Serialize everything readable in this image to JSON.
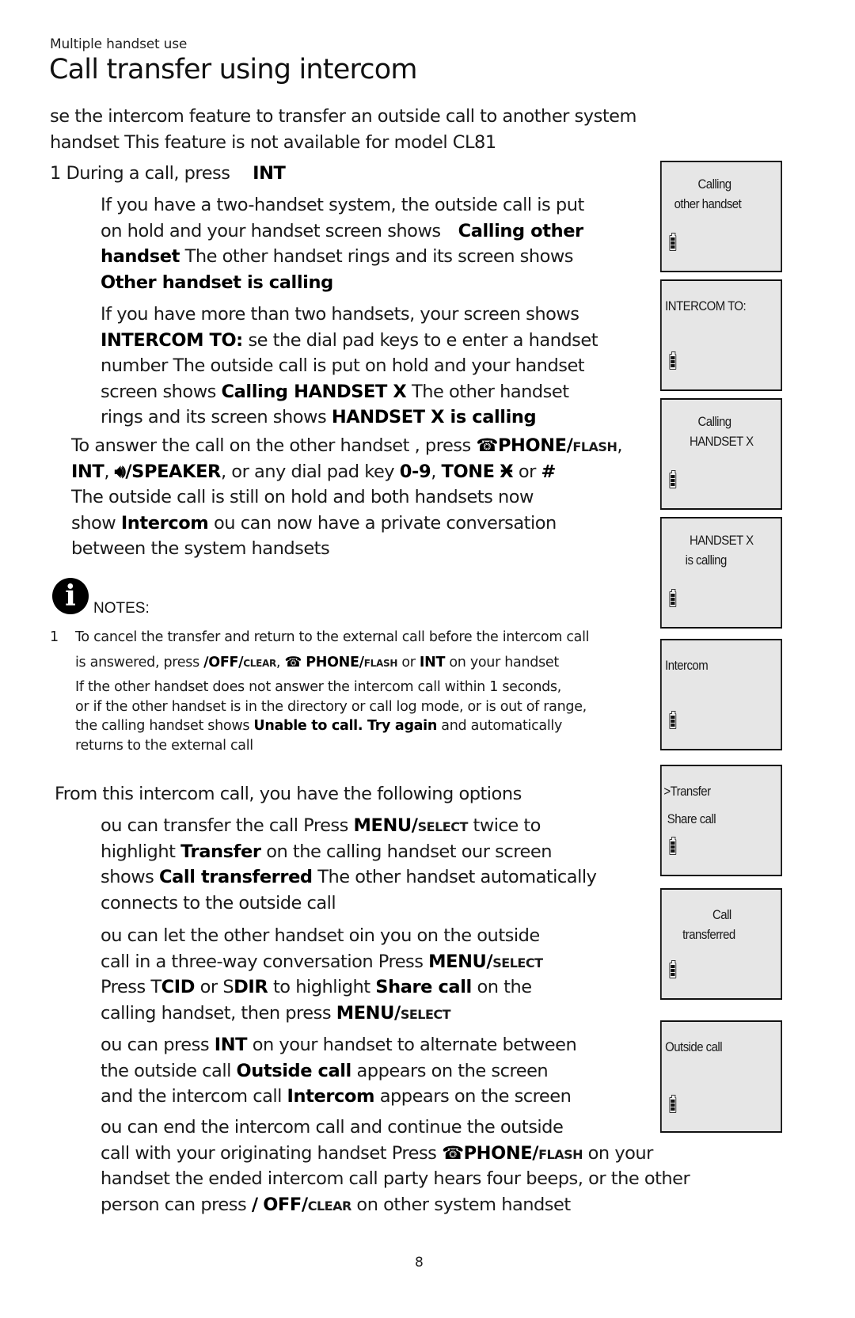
{
  "header": {
    "section_label": "Multiple handset use",
    "title": "Call transfer using intercom"
  },
  "intro": {
    "line1": "se the intercom feature to transfer an outside call to another system",
    "line2": "handset This feature is not available for model CL81"
  },
  "step1": {
    "prefix": "1 During a call, press",
    "key": "INT",
    "two_handset": {
      "l1": "If you have a   two-handset  system,  the outside call is put",
      "l2_pre": "on hold  and  your handset screen shows",
      "l2_bold": "Calling other",
      "l3_bold": "handset",
      "l3_post": " The other handset rings and its screen shows",
      "l4_bold": "Other handset is calling"
    },
    "multi_handset": {
      "l1": "If you have more than   two  handsets, your screen shows",
      "l2_bold": "INTERCOM TO:",
      "l2_post": " se the dial pad keys to e   enter a handset",
      "l3": "number The   outside call is put on hold and your handset",
      "l4_pre": "screen shows ",
      "l4_bold": "Calling HANDSET X",
      "l4_post": " The other handset",
      "l5_pre": "rings and its screen shows   ",
      "l5_bold": "HANDSET X is calling"
    }
  },
  "answer": {
    "l1_pre": "To answer the call on the other handset   , press ",
    "phone_icon": "phone-handset-icon",
    "phone_key": "PHONE/",
    "flash_key": "FLASH",
    "int_key": "INT",
    "speaker_icon": "speaker-icon",
    "speaker_key": "/SPEAKER",
    "l2_mid": ", or any dial pad key    ",
    "digits_key": "0-9",
    "tone_key": "TONE",
    "tone_glyph": "Ӿ",
    "l2_or": " or ",
    "hash_key": "#",
    "l3": "The outside call is still on hold and both handsets now",
    "l4_pre": "show  ",
    "l4_bold": "Intercom",
    "l4_post": " ou can now have a private conversation",
    "l5": "between the system handsets"
  },
  "notes": {
    "label": "NOTES:",
    "icon": "info-icon",
    "item1_num": "1",
    "item1_l1": "To cancel the transfer and return to the external call before the intercom call",
    "item1_l2_pre": "is answered, press  ",
    "off_icon": "off-handset-icon",
    "off_key": "OFF/",
    "clear_key": "CLEAR",
    "phone_key": "PHONE/",
    "flash_key": "FLASH",
    "or": " or ",
    "int_key": "INT",
    "item1_l2_post": " on your handset",
    "item2_l1": "If the other handset does not answer the intercom call within 1 seconds,",
    "item2_l2": "or if the other handset is in the directory or call log mode, or is out of range,",
    "item2_l3_pre": "the calling handset shows   ",
    "item2_l3_bold": "Unable to call. Try again",
    "item2_l3_post": " and automatically",
    "item2_l4": "returns to the external call"
  },
  "options": {
    "intro": "From this intercom call, you have the following options",
    "transfer": {
      "l1_pre": "ou can transfer the call Press      ",
      "menu_key": "MENU/",
      "select_key": "SELECT",
      "l1_post": " twice to",
      "l2_pre": "highlight  ",
      "l2_bold": "Transfer",
      "l2_post": " on  the calling  handset our screen",
      "l3_pre": "shows  ",
      "l3_bold": "Call transferred",
      "l3_post": " The other handset automatically",
      "l4": "connects to the outside call"
    },
    "share": {
      "l1": "ou can let the other handset oin you on the outside",
      "l2_pre": "call in a three-way conversation Press    ",
      "menu_key": "MENU/",
      "select_key": "SELECT",
      "l3_pre": "Press  ",
      "up_glyph": "T",
      "cid_key": "CID",
      "l3_or": " or  ",
      "down_glyph": "S",
      "dir_key": "DIR",
      "l3_mid": " to  highlight  ",
      "l3_bold": "Share call",
      "l3_post": " on  the",
      "l4_pre": "calling  handset, then press  "
    },
    "alternate": {
      "l1_pre": "ou can press    ",
      "int_key": "INT",
      "l1_post": " on your handset to alternate between",
      "l2_pre": "the outside call   ",
      "l2_bold": "Outside call",
      "l2_post": " appears on the screen",
      "l3_pre": "and the intercom call   ",
      "l3_bold": "Intercom",
      "l3_post": " appears on the screen"
    },
    "end": {
      "l1": "ou can end the intercom call and continue the outside",
      "l2_pre": "call with your originating handset Press     ",
      "phone_key": "PHONE/",
      "flash_key": "FLASH",
      "l2_post": " on your",
      "l3": "handset  the ended intercom call party hears four beeps,       or the other",
      "l4_pre": "person can press  ",
      "off_key": "OFF/",
      "clear_key": "CLEAR",
      "l4_post": " on other system handset"
    }
  },
  "screens": [
    {
      "name": "screen-calling-other-handset",
      "line1": "Calling",
      "line2": "other handset",
      "battery_level": "full"
    },
    {
      "name": "screen-intercom-to",
      "line1": "INTERCOM TO:",
      "line2": "",
      "battery_level": "full"
    },
    {
      "name": "screen-calling-handset-x",
      "line1": "Calling",
      "line2": "HANDSET X",
      "battery_level": "full"
    },
    {
      "name": "screen-handset-x-is-calling",
      "line1": "HANDSET X",
      "line2": "is calling",
      "battery_level": "full"
    },
    {
      "name": "screen-intercom",
      "line1": "Intercom",
      "line2": "",
      "battery_level": "full"
    },
    {
      "name": "screen-transfer-menu",
      "line1": ">Transfer",
      "line2": "Share call",
      "battery_level": "full"
    },
    {
      "name": "screen-call-transferred",
      "line1": "Call",
      "line2": "transferred",
      "battery_level": "full"
    },
    {
      "name": "screen-outside-call",
      "line1": "Outside call",
      "line2": "",
      "battery_level": "full"
    }
  ],
  "footer": {
    "page_number": "8"
  }
}
